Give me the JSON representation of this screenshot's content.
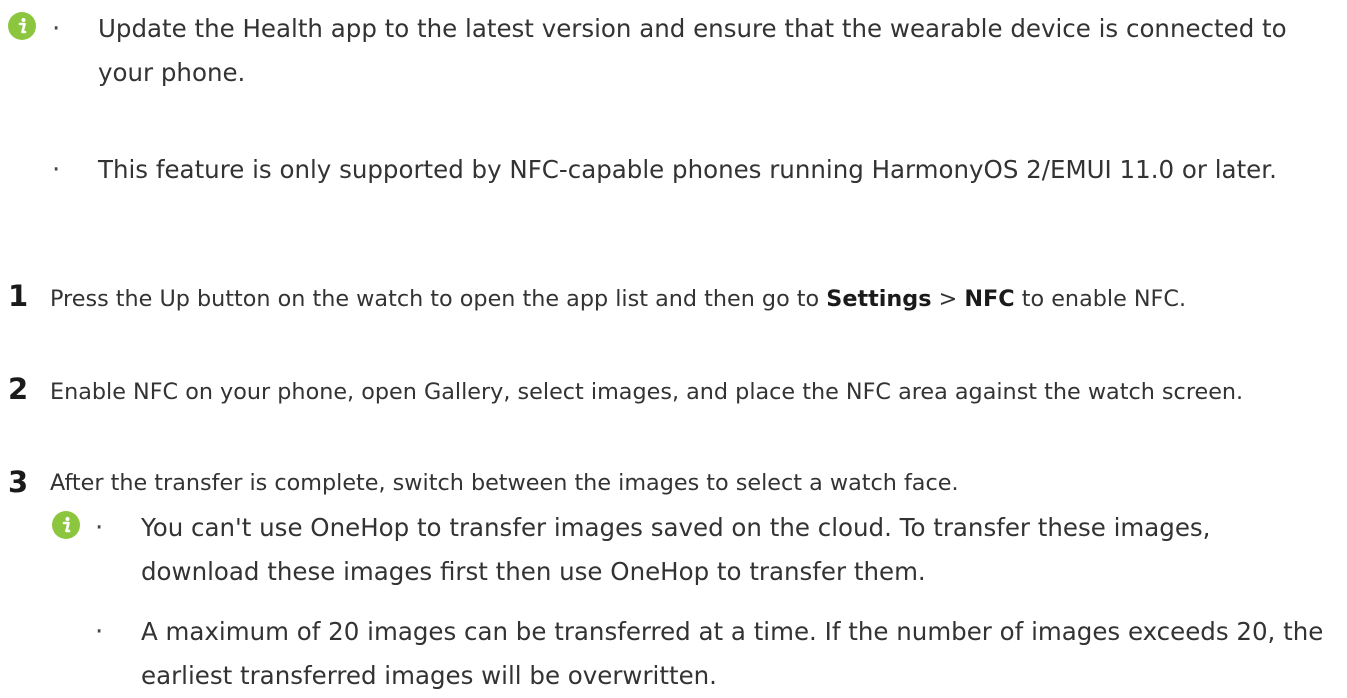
{
  "top_note": {
    "icon": "info-icon",
    "items": [
      "Update the Health app to the latest version and ensure that the wearable device is connected to your phone.",
      "This feature is only supported by NFC-capable phones running HarmonyOS 2/EMUI 11.0 or later."
    ]
  },
  "steps": [
    {
      "number": "1",
      "before": "Press the Up button on the watch to open the app list and then go to ",
      "bold1": "Settings",
      "middle": " > ",
      "bold2": "NFC",
      "after": " to enable NFC."
    },
    {
      "number": "2",
      "text": "Enable NFC on your phone, open Gallery, select images, and place the NFC area against the watch screen."
    },
    {
      "number": "3",
      "text": "After the transfer is complete, switch between the images to select a watch face."
    }
  ],
  "step3_note": {
    "icon": "info-icon",
    "items": [
      "You can't use OneHop to transfer images saved on the cloud. To transfer these images, download these images first then use OneHop to transfer them.",
      "A maximum of 20 images can be transferred at a time. If the number of images exceeds 20, the earliest transferred images will be overwritten."
    ]
  },
  "colors": {
    "icon": "#8cc63f",
    "text": "#333333"
  }
}
